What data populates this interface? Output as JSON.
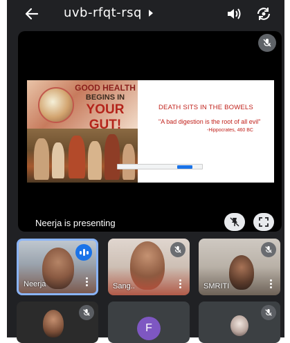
{
  "meeting": {
    "code": "uvb-rfqt-rsq"
  },
  "presentation": {
    "status_text": "Neerja is presenting",
    "slide": {
      "headline_1": "GOOD HEALTH",
      "headline_2": "BEGINS IN",
      "headline_3": "YOUR GUT!",
      "title": "DEATH SITS IN THE BOWELS",
      "quote": "\"A bad digestion is the root of all evil\"",
      "attribution": "-Hippocrates, 460 BC"
    }
  },
  "participants": [
    {
      "name": "Neerja",
      "speaking": true
    },
    {
      "name": "Sang..",
      "muted": true
    },
    {
      "name": "SMRITI",
      "muted": true
    },
    {
      "name": "",
      "muted": true
    },
    {
      "name": "",
      "avatar_letter": "F"
    },
    {
      "name": "",
      "muted": true
    }
  ],
  "colors": {
    "accent": "#1a73e8",
    "active_border": "#8ab4f8",
    "avatar_f": "#7e57c2",
    "slide_red": "#c0201a"
  }
}
